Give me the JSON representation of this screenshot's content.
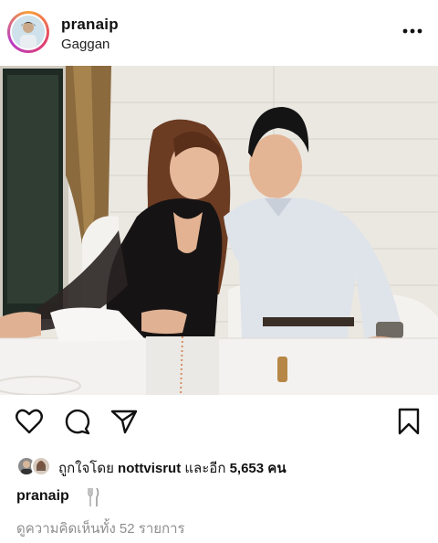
{
  "post": {
    "username": "pranaip",
    "location": "Gaggan"
  },
  "header": {
    "more_icon": "more-horizontal-icon"
  },
  "actions": {
    "icons": [
      "heart-icon",
      "comment-icon",
      "share-icon",
      "bookmark-icon"
    ]
  },
  "likes": {
    "prefix": "ถูกใจโดย",
    "user": "nottvisrut",
    "middle": "และอีก",
    "count": "5,653",
    "suffix": "คน"
  },
  "caption": {
    "username": "pranaip",
    "emoji_icon": "fork-knife-icon"
  },
  "comments": {
    "view_all": "ดูความคิดเห็นทั้ง 52 รายการ"
  },
  "colors": {
    "text": "#111111",
    "muted": "#8e8e8e",
    "story_ring": "#e23f6b"
  }
}
